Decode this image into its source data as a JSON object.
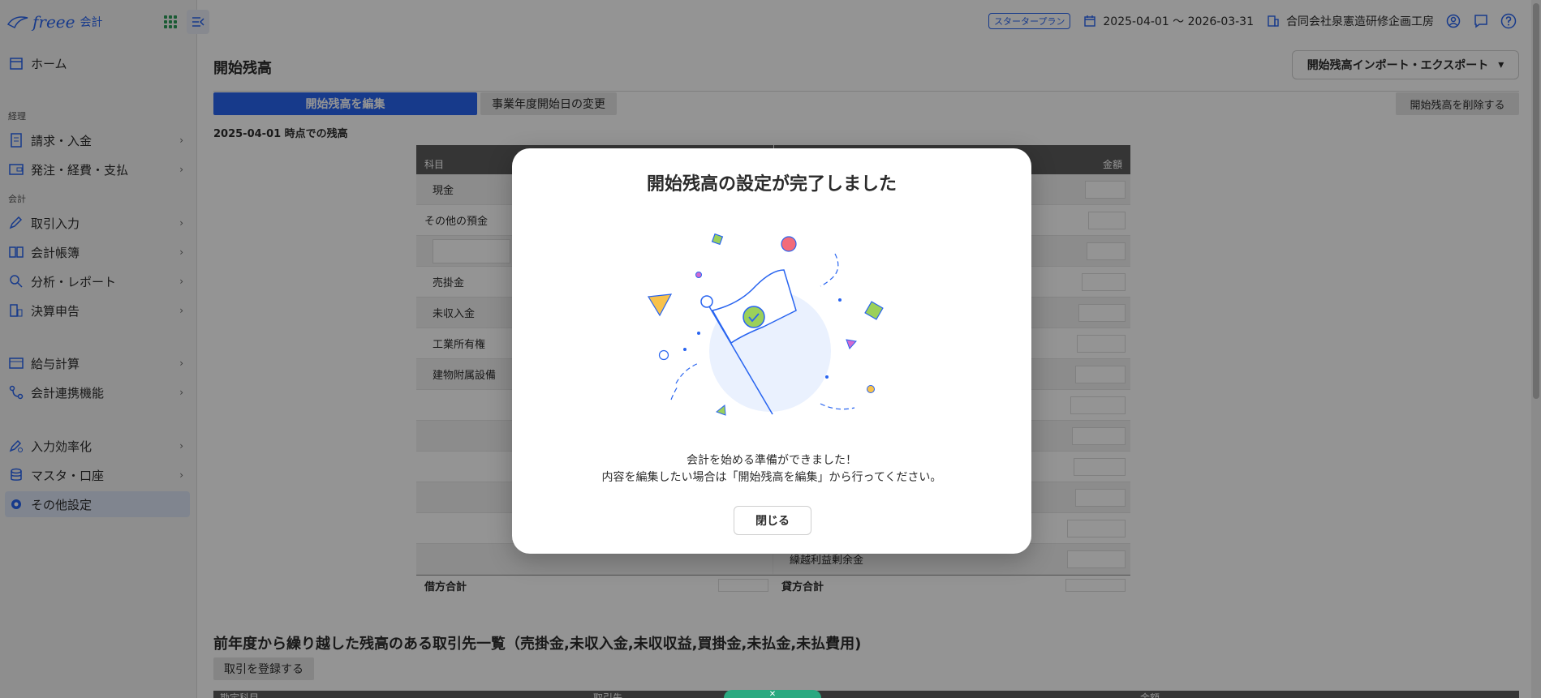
{
  "app": {
    "logo_text": "freee",
    "app_name": "会計"
  },
  "sidebar": {
    "home": "ホーム",
    "section_keiri": "経理",
    "section_kaikei": "会計",
    "items": [
      {
        "label": "請求・入金"
      },
      {
        "label": "発注・経費・支払"
      },
      {
        "label": "取引入力"
      },
      {
        "label": "会計帳簿"
      },
      {
        "label": "分析・レポート"
      },
      {
        "label": "決算申告"
      },
      {
        "label": "給与計算"
      },
      {
        "label": "会計連携機能"
      },
      {
        "label": "入力効率化"
      },
      {
        "label": "マスタ・口座"
      },
      {
        "label": "その他設定"
      }
    ]
  },
  "header": {
    "plan": "スタータープラン",
    "period": "2025-04-01 〜 2026-03-31",
    "company": "合同会社泉憲造研修企画工房"
  },
  "main": {
    "page_title": "開始残高",
    "import_export": "開始残高インポート・エクスポート",
    "tab_edit": "開始残高を編集",
    "tab_change_date": "事業年度開始日の変更",
    "delete_button": "開始残高を削除する",
    "as_of": "2025-04-01 時点での残高",
    "table": {
      "col_account": "科目",
      "col_amount": "金額",
      "left_rows": [
        "現金",
        "その他の預金",
        "",
        "売掛金",
        "未収入金",
        "工業所有権",
        "建物附属設備",
        "",
        "",
        "",
        "",
        "",
        ""
      ],
      "right_rows": [
        "",
        "",
        "",
        "",
        "",
        "",
        "",
        "",
        "",
        "",
        "",
        "",
        "繰越利益剰余金"
      ],
      "debit_total": "借方合計",
      "credit_total": "貸方合計"
    },
    "carryover_title": "前年度から繰り越した残高のある取引先一覧（売掛金,未収入金,未収収益,買掛金,未払金,未払費用)",
    "register_button": "取引を登録する",
    "list_cols": [
      "勘定科目",
      "取引先",
      "金額"
    ]
  },
  "modal": {
    "title": "開始残高の設定が完了しました",
    "message_line1": "会計を始める準備ができました！",
    "message_line2": "内容を編集したい場合は「開始残高を編集」から行ってください。",
    "close": "閉じる"
  },
  "colors": {
    "brand": "#2864f0",
    "primary_button": "#2864f0",
    "check_green": "#9bd05a"
  }
}
